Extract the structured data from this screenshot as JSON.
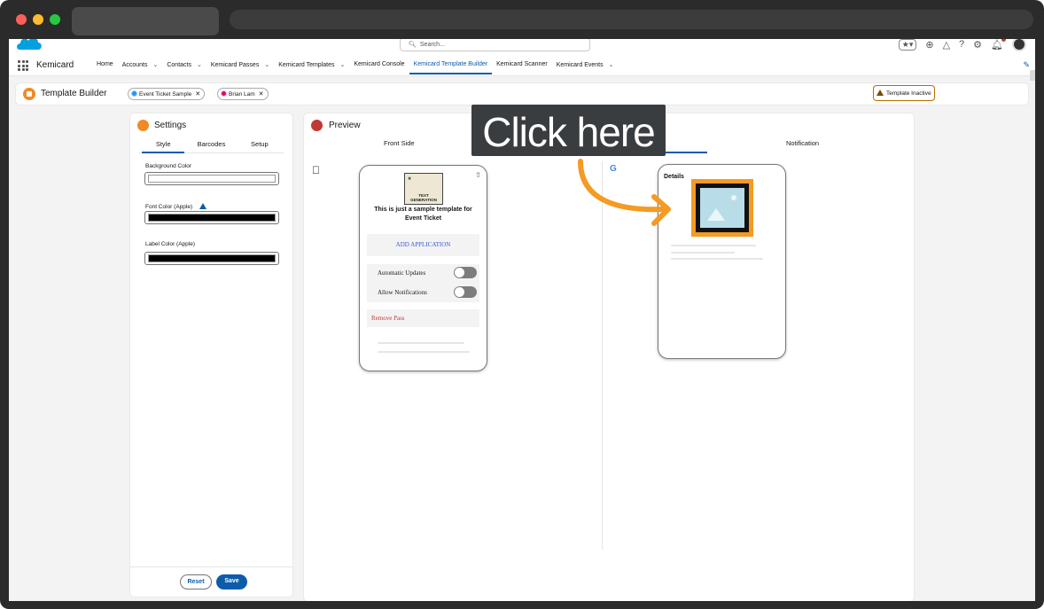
{
  "header": {
    "search_placeholder": "Search...",
    "app_name": "Kemicard"
  },
  "nav": {
    "items": [
      {
        "label": "Home",
        "has_menu": false
      },
      {
        "label": "Accounts",
        "has_menu": true
      },
      {
        "label": "Contacts",
        "has_menu": true
      },
      {
        "label": "Kemicard Passes",
        "has_menu": true
      },
      {
        "label": "Kemicard Templates",
        "has_menu": true
      },
      {
        "label": "Kemicard Console",
        "has_menu": false
      },
      {
        "label": "Kemicard Template Builder",
        "has_menu": false,
        "active": true
      },
      {
        "label": "Kemicard Scanner",
        "has_menu": false
      },
      {
        "label": "Kemicard Events",
        "has_menu": true
      }
    ]
  },
  "page_header": {
    "title": "Template Builder",
    "event_pill": "Event Ticket Sample",
    "user_pill": "Brian Lam",
    "status_badge": "Template Inactive"
  },
  "settings": {
    "title": "Settings",
    "tabs": [
      "Style",
      "Barcodes",
      "Setup"
    ],
    "active_tab": "Style",
    "fields": {
      "background_label": "Background Color",
      "background_value": "#ffffff",
      "font_label": "Font Color (Apple)",
      "font_value": "#000000",
      "label_label": "Label Color (Apple)",
      "label_value": "#000000"
    },
    "reset_label": "Reset",
    "save_label": "Save"
  },
  "preview": {
    "title": "Preview",
    "tab_front": "Front Side",
    "tab_notification": "Notification",
    "apple_card": {
      "thumb_text": "TEXT GENERATION",
      "sample_text": "This is just a sample template for Event Ticket",
      "add_application": "ADD APPLICATION",
      "automatic_updates": "Automatic Updates",
      "allow_notifications": "Allow Notifications",
      "remove_pass": "Remove Pass"
    },
    "google_card": {
      "details_title": "Details"
    }
  },
  "annotation": {
    "label": "Click here"
  },
  "colors": {
    "accent": "#0b5cab",
    "highlight": "#f59a23",
    "annotation_bg": "#3a3d40"
  }
}
